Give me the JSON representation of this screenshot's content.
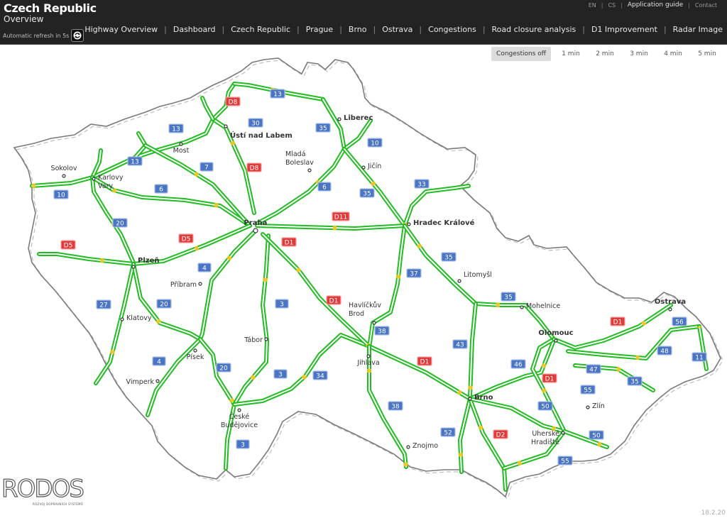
{
  "header": {
    "title": "Czech Republic",
    "subtitle": "Overview",
    "refresh_text": "Automatic refresh in 5s",
    "refresh_icon": "refresh-icon"
  },
  "utility_links": [
    {
      "label": "EN"
    },
    {
      "label": "CS"
    },
    {
      "label": "Application guide"
    },
    {
      "label": "Contact"
    }
  ],
  "nav": [
    {
      "label": "Highway Overview"
    },
    {
      "label": "Dashboard"
    },
    {
      "label": "Czech Republic"
    },
    {
      "label": "Prague"
    },
    {
      "label": "Brno"
    },
    {
      "label": "Ostrava"
    },
    {
      "label": "Congestions"
    },
    {
      "label": "Road closure analysis"
    },
    {
      "label": "D1 Improvement"
    },
    {
      "label": "Radar Image"
    }
  ],
  "time_options": [
    {
      "label": "Congestions off",
      "active": true
    },
    {
      "label": "1 min",
      "active": false
    },
    {
      "label": "2 min",
      "active": false
    },
    {
      "label": "3 min",
      "active": false
    },
    {
      "label": "4 min",
      "active": false
    },
    {
      "label": "5 min",
      "active": false
    }
  ],
  "colors": {
    "road_free": "#22bb22",
    "road_slow": "#f5c518",
    "road_jam": "#e02020",
    "motorway_badge": "#e03a3a",
    "road_badge": "#4a74c4",
    "border": "#7a7a7a",
    "header_bg": "#232323"
  },
  "map": {
    "cities": [
      {
        "name": "Praha",
        "bold": true,
        "major": true
      },
      {
        "name": "Liberec",
        "bold": true
      },
      {
        "name": "Ústí nad Labem",
        "bold": true
      },
      {
        "name": "Hradec Králové",
        "bold": true
      },
      {
        "name": "Plzeň",
        "bold": true
      },
      {
        "name": "Brno",
        "bold": true
      },
      {
        "name": "Olomouc",
        "bold": true
      },
      {
        "name": "Ostrava",
        "bold": true
      },
      {
        "name": "Sokolov",
        "bold": false
      },
      {
        "name": "Karlovy Vary",
        "bold": false
      },
      {
        "name": "Most",
        "bold": false
      },
      {
        "name": "Mladá Boleslav",
        "bold": false
      },
      {
        "name": "Jičín",
        "bold": false
      },
      {
        "name": "Litomyšl",
        "bold": false
      },
      {
        "name": "Mohelnice",
        "bold": false
      },
      {
        "name": "Příbram",
        "bold": false
      },
      {
        "name": "Klatovy",
        "bold": false
      },
      {
        "name": "Tábor",
        "bold": false
      },
      {
        "name": "Písek",
        "bold": false
      },
      {
        "name": "Havlíčkův Brod",
        "bold": false
      },
      {
        "name": "Jihlava",
        "bold": false
      },
      {
        "name": "Vimperk",
        "bold": false
      },
      {
        "name": "České Budějovice",
        "bold": false
      },
      {
        "name": "Znojmo",
        "bold": false
      },
      {
        "name": "Zlín",
        "bold": false
      },
      {
        "name": "Uherské Hradiště",
        "bold": false
      }
    ],
    "badges": [
      {
        "label": "D8",
        "type": "motorway"
      },
      {
        "label": "13",
        "type": "road"
      },
      {
        "label": "30",
        "type": "road"
      },
      {
        "label": "13",
        "type": "road"
      },
      {
        "label": "35",
        "type": "road"
      },
      {
        "label": "13",
        "type": "road"
      },
      {
        "label": "D8",
        "type": "motorway"
      },
      {
        "label": "7",
        "type": "road"
      },
      {
        "label": "10",
        "type": "road"
      },
      {
        "label": "6",
        "type": "road"
      },
      {
        "label": "6",
        "type": "road"
      },
      {
        "label": "10",
        "type": "road"
      },
      {
        "label": "35",
        "type": "road"
      },
      {
        "label": "33",
        "type": "road"
      },
      {
        "label": "20",
        "type": "road"
      },
      {
        "label": "D11",
        "type": "motorway"
      },
      {
        "label": "D5",
        "type": "motorway"
      },
      {
        "label": "D5",
        "type": "motorway"
      },
      {
        "label": "D1",
        "type": "motorway"
      },
      {
        "label": "35",
        "type": "road"
      },
      {
        "label": "4",
        "type": "road"
      },
      {
        "label": "37",
        "type": "road"
      },
      {
        "label": "27",
        "type": "road"
      },
      {
        "label": "20",
        "type": "road"
      },
      {
        "label": "3",
        "type": "road"
      },
      {
        "label": "D1",
        "type": "motorway"
      },
      {
        "label": "35",
        "type": "road"
      },
      {
        "label": "D1",
        "type": "motorway"
      },
      {
        "label": "56",
        "type": "road"
      },
      {
        "label": "38",
        "type": "road"
      },
      {
        "label": "43",
        "type": "road"
      },
      {
        "label": "48",
        "type": "road"
      },
      {
        "label": "4",
        "type": "road"
      },
      {
        "label": "D1",
        "type": "motorway"
      },
      {
        "label": "46",
        "type": "road"
      },
      {
        "label": "47",
        "type": "road"
      },
      {
        "label": "11",
        "type": "road"
      },
      {
        "label": "20",
        "type": "road"
      },
      {
        "label": "3",
        "type": "road"
      },
      {
        "label": "34",
        "type": "road"
      },
      {
        "label": "D1",
        "type": "motorway"
      },
      {
        "label": "35",
        "type": "road"
      },
      {
        "label": "55",
        "type": "road"
      },
      {
        "label": "38",
        "type": "road"
      },
      {
        "label": "50",
        "type": "road"
      },
      {
        "label": "52",
        "type": "road"
      },
      {
        "label": "D2",
        "type": "motorway"
      },
      {
        "label": "50",
        "type": "road"
      },
      {
        "label": "3",
        "type": "road"
      },
      {
        "label": "55",
        "type": "road"
      }
    ]
  },
  "logo": {
    "text": "RODOS",
    "tagline": "ROZVOJ DOPRAVNÍCH SYSTÉMŮ"
  },
  "version": "18.2.20"
}
